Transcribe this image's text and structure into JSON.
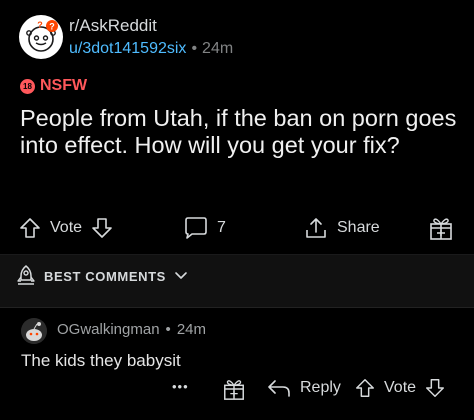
{
  "post": {
    "subreddit": "r/AskReddit",
    "username": "u/3dot141592six",
    "separator": "•",
    "time": "24m",
    "nsfw_badge": "18",
    "nsfw_label": "NSFW",
    "title": "People from Utah, if the ban on porn goes into effect. How will you get your fix?",
    "actions": {
      "vote_label": "Vote",
      "comment_count": "7",
      "share_label": "Share"
    }
  },
  "sort": {
    "label": "BEST COMMENTS"
  },
  "comment": {
    "username": "OGwalkingman",
    "separator": "•",
    "time": "24m",
    "body": "The kids they babysit",
    "actions": {
      "more": "•••",
      "reply_label": "Reply",
      "vote_label": "Vote"
    }
  },
  "colors": {
    "background": "#000000",
    "text": "#d7dadc",
    "username_link": "#4fbcff",
    "nsfw": "#ff585b",
    "muted": "#818384"
  }
}
